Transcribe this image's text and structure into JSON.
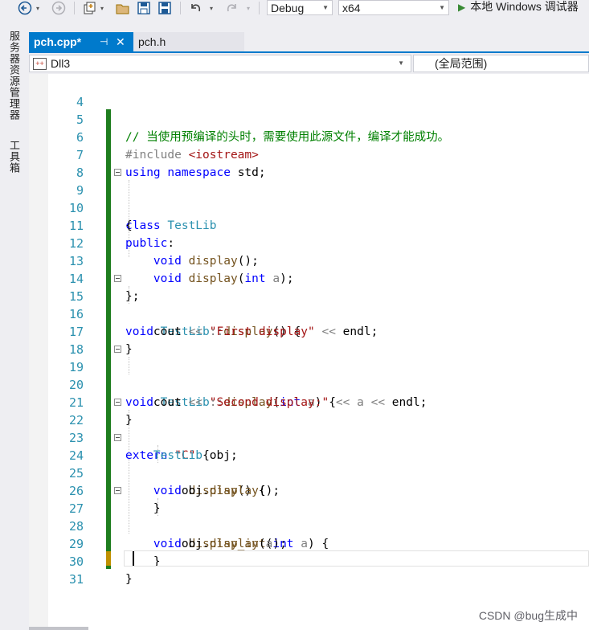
{
  "toolbar": {
    "config": "Debug",
    "platform": "x64",
    "run_label": "本地 Windows 调试器"
  },
  "side_panels": [
    "服务器资源管理器",
    "工具箱"
  ],
  "tabs": [
    {
      "label": "pch.cpp*",
      "active": true
    },
    {
      "label": "pch.h",
      "active": false
    }
  ],
  "nav": {
    "project": "Dll3",
    "scope": "(全局范围)"
  },
  "editor": {
    "lines": [
      "4",
      "5",
      "6",
      "7",
      "8",
      "9",
      "10",
      "11",
      "12",
      "13",
      "14",
      "15",
      "16",
      "17",
      "18",
      "19",
      "20",
      "21",
      "22",
      "23",
      "24",
      "25",
      "26",
      "27",
      "28",
      "29",
      "30",
      "31"
    ],
    "code": {
      "l5_comment": "// 当使用预编译的头时，需要使用此源文件，编译才能成功。",
      "l6_include": "#include",
      "l6_header": "<iostream>",
      "l7_using": "using",
      "l7_namespace": "namespace",
      "l7_std": "std;",
      "l9_class": "class",
      "l9_name": "TestLib",
      "l10": "{",
      "l11_public": "public",
      "l11_colon": ":",
      "l12_void": "void",
      "l12_fn": "display",
      "l12_rest": "();",
      "l13_void": "void",
      "l13_fn": "display",
      "l13_open": "(",
      "l13_int": "int",
      "l13_param": "a",
      "l13_close": ");",
      "l14": "};",
      "l15_void": "void",
      "l15_cls": "TestLib",
      "l15_sep": "::",
      "l15_fn": "display",
      "l15_rest": "() {",
      "l16_cout": "cout",
      "l16_op1": "<<",
      "l16_str": "\"First display\"",
      "l16_op2": "<<",
      "l16_endl": "endl;",
      "l17": "}",
      "l19_void": "void",
      "l19_cls": "TestLib",
      "l19_sep": "::",
      "l19_fn": "display",
      "l19_open": "(",
      "l19_int": "int",
      "l19_param": "a",
      "l19_close": ") {",
      "l20_cout": "cout",
      "l20_op1": "<<",
      "l20_str": "\"Second display:\"",
      "l20_op2": "<<",
      "l20_a": "a",
      "l20_op3": "<<",
      "l20_endl": "endl;",
      "l21": "}",
      "l22_extern": "extern",
      "l22_str": "\"C\"",
      "l22_brace": "{",
      "l23_type": "TestLib",
      "l23_rest": "obj;",
      "l24_void": "void",
      "l24_fn": "display",
      "l24_rest": "() {",
      "l25_obj": "obj.",
      "l25_fn": "display",
      "l25_rest": "();",
      "l26": "}",
      "l27_void": "void",
      "l27_fn": "display_int",
      "l27_open": "(",
      "l27_int": "int",
      "l27_param": "a",
      "l27_close": ") {",
      "l28_obj": "obj.",
      "l28_fn": "display",
      "l28_open": "(",
      "l28_param": "a",
      "l28_close": ");",
      "l29": "}",
      "l30": "}"
    }
  },
  "watermark": "CSDN @bug生成中",
  "colors": {
    "accent": "#007acc",
    "keyword": "#0000ff",
    "type": "#2b91af",
    "comment": "#008000",
    "string": "#a31515",
    "saved_change": "#1e7d1e",
    "unsaved_change": "#c09000"
  }
}
